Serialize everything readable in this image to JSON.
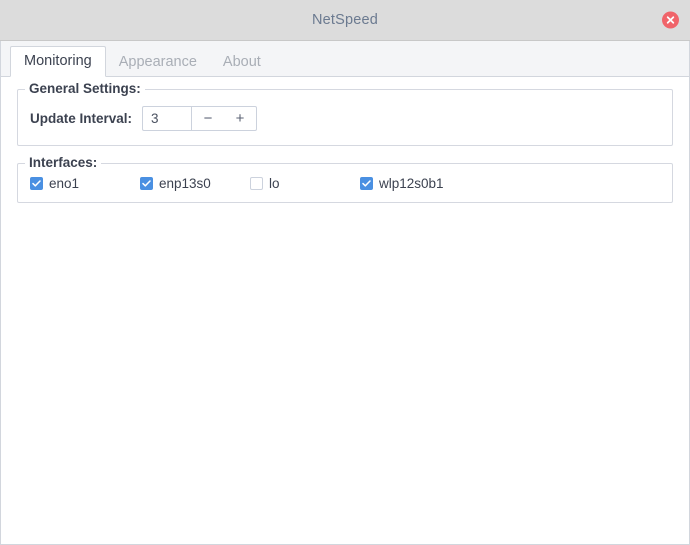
{
  "window": {
    "title": "NetSpeed",
    "close_icon": "close-circle-icon",
    "accent_color": "#4a90e2",
    "close_color": "#f0646a",
    "titlebar_color": "#dcdcdc"
  },
  "tabs": [
    {
      "label": "Monitoring",
      "active": true
    },
    {
      "label": "Appearance",
      "active": false
    },
    {
      "label": "About",
      "active": false
    }
  ],
  "general_settings": {
    "title": "General Settings:",
    "update_interval": {
      "label": "Update Interval:",
      "value": "3",
      "placeholder": "",
      "decrement_label": "−",
      "increment_label": "+",
      "decrement_icon": "minus-icon",
      "increment_icon": "plus-icon"
    }
  },
  "interfaces": {
    "title": "Interfaces:",
    "items": [
      {
        "name": "eno1",
        "checked": true
      },
      {
        "name": "enp13s0",
        "checked": true
      },
      {
        "name": "lo",
        "checked": false
      },
      {
        "name": "wlp12s0b1",
        "checked": true
      }
    ]
  }
}
